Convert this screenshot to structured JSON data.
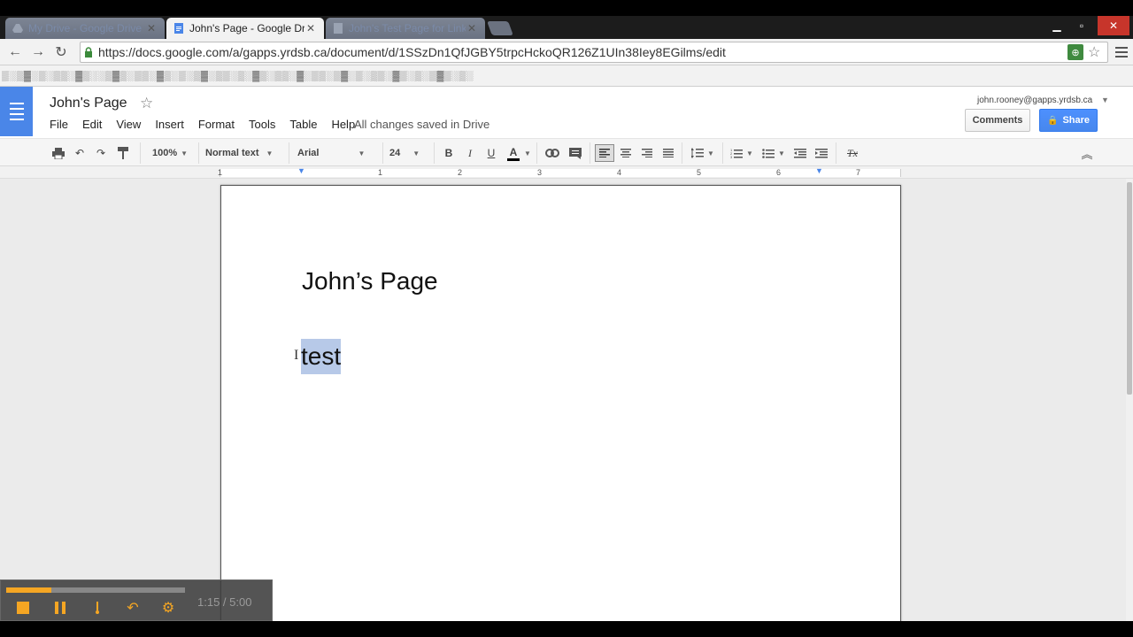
{
  "browser": {
    "tabs": [
      {
        "title": "My Drive - Google Drive",
        "active": false
      },
      {
        "title": "John's Page - Google Drive",
        "active": true
      },
      {
        "title": "John's Test Page for Links",
        "active": false
      }
    ],
    "url": "https://docs.google.com/a/gapps.yrdsb.ca/document/d/1SSzDn1QfJGBY5trpcHckoQR126Z1UIn38Iey8EGilms/edit"
  },
  "docs": {
    "title": "John's Page",
    "menu": [
      "File",
      "Edit",
      "View",
      "Insert",
      "Format",
      "Tools",
      "Table",
      "Help"
    ],
    "save_status": "All changes saved in Drive",
    "account": "john.rooney@gapps.yrdsb.ca",
    "comments_label": "Comments",
    "share_label": "Share"
  },
  "toolbar": {
    "zoom": "100%",
    "style": "Normal text",
    "font": "Arial",
    "size": "24",
    "bold": "B",
    "italic": "I",
    "underline": "U",
    "text_color": "A",
    "clear_format": "Tx"
  },
  "ruler": {
    "numbers": [
      "1",
      "1",
      "2",
      "3",
      "4",
      "5",
      "6",
      "7"
    ]
  },
  "document": {
    "heading": "John’s Page",
    "selected_text": "test"
  },
  "recorder": {
    "progress": 0.25,
    "time": "1:15 / 5:00"
  },
  "colors": {
    "docs_blue": "#4a86e8",
    "share_blue": "#4d90fe",
    "selection": "#b7c9e8",
    "recorder_accent": "#f5a623"
  }
}
